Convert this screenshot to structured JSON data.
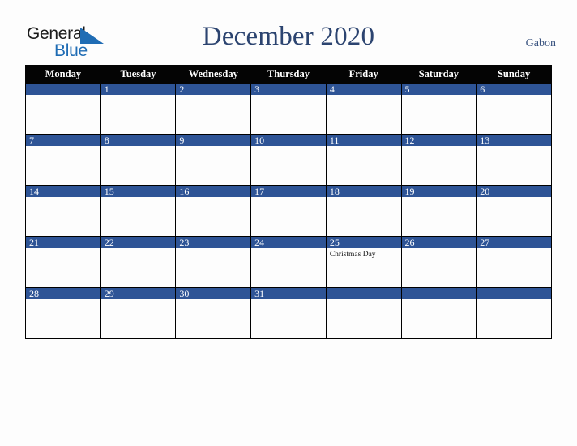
{
  "brand": {
    "name_part1": "General",
    "name_part2": "Blue",
    "triangle_icon": "triangle-icon",
    "color_dark": "#1b1b1b",
    "color_blue": "#1f6cb4"
  },
  "header": {
    "title": "December 2020",
    "country": "Gabon",
    "title_color": "#2c4470"
  },
  "calendar": {
    "month": "December",
    "year": "2020",
    "weekday_headers": [
      "Monday",
      "Tuesday",
      "Wednesday",
      "Thursday",
      "Friday",
      "Saturday",
      "Sunday"
    ],
    "header_bg": "#040404",
    "daynum_bg": "#2e5496",
    "cell_bg": "#fdfdfd",
    "weeks": [
      [
        {
          "day": "",
          "event": ""
        },
        {
          "day": "1",
          "event": ""
        },
        {
          "day": "2",
          "event": ""
        },
        {
          "day": "3",
          "event": ""
        },
        {
          "day": "4",
          "event": ""
        },
        {
          "day": "5",
          "event": ""
        },
        {
          "day": "6",
          "event": ""
        }
      ],
      [
        {
          "day": "7",
          "event": ""
        },
        {
          "day": "8",
          "event": ""
        },
        {
          "day": "9",
          "event": ""
        },
        {
          "day": "10",
          "event": ""
        },
        {
          "day": "11",
          "event": ""
        },
        {
          "day": "12",
          "event": ""
        },
        {
          "day": "13",
          "event": ""
        }
      ],
      [
        {
          "day": "14",
          "event": ""
        },
        {
          "day": "15",
          "event": ""
        },
        {
          "day": "16",
          "event": ""
        },
        {
          "day": "17",
          "event": ""
        },
        {
          "day": "18",
          "event": ""
        },
        {
          "day": "19",
          "event": ""
        },
        {
          "day": "20",
          "event": ""
        }
      ],
      [
        {
          "day": "21",
          "event": ""
        },
        {
          "day": "22",
          "event": ""
        },
        {
          "day": "23",
          "event": ""
        },
        {
          "day": "24",
          "event": ""
        },
        {
          "day": "25",
          "event": "Christmas Day"
        },
        {
          "day": "26",
          "event": ""
        },
        {
          "day": "27",
          "event": ""
        }
      ],
      [
        {
          "day": "28",
          "event": ""
        },
        {
          "day": "29",
          "event": ""
        },
        {
          "day": "30",
          "event": ""
        },
        {
          "day": "31",
          "event": ""
        },
        {
          "day": "",
          "event": ""
        },
        {
          "day": "",
          "event": ""
        },
        {
          "day": "",
          "event": ""
        }
      ]
    ]
  }
}
